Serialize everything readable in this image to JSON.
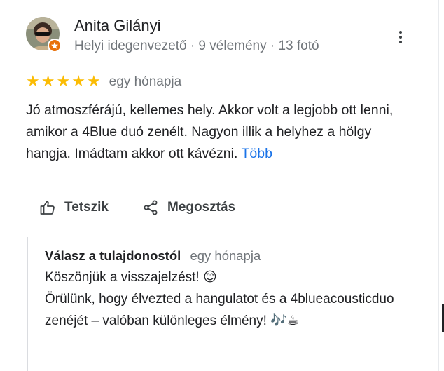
{
  "review": {
    "author_name": "Anita Gilányi",
    "author_meta": "Helyi idegenvezető · 9 vélemény · 13 fotó",
    "rating": 5,
    "stars": [
      "★",
      "★",
      "★",
      "★",
      "★"
    ],
    "date": "egy hónapja",
    "text": "Jó atmoszférájú, kellemes hely. Akkor volt a legjobb ott lenni, amikor a 4Blue duó zenélt. Nagyon illik a helyhez a hölgy hangja. Imádtam akkor ott kávézni.",
    "more_label": "Több"
  },
  "actions": {
    "like_label": "Tetszik",
    "share_label": "Megosztás"
  },
  "owner_reply": {
    "title": "Válasz a tulajdonostól",
    "date": "egy hónapja",
    "text": "Köszönjük a visszajelzést! 😊\nÖrülünk, hogy élvezted a hangulatot és a 4blueacousticduo zenéjét – valóban különleges élmény! 🎶☕"
  },
  "colors": {
    "star": "#fbbc04",
    "link": "#1a73e8",
    "secondary_text": "#70757a",
    "badge": "#e8710a"
  },
  "icons": [
    "more-vert-icon",
    "thumb-up-icon",
    "share-icon",
    "local-guide-badge-icon"
  ]
}
